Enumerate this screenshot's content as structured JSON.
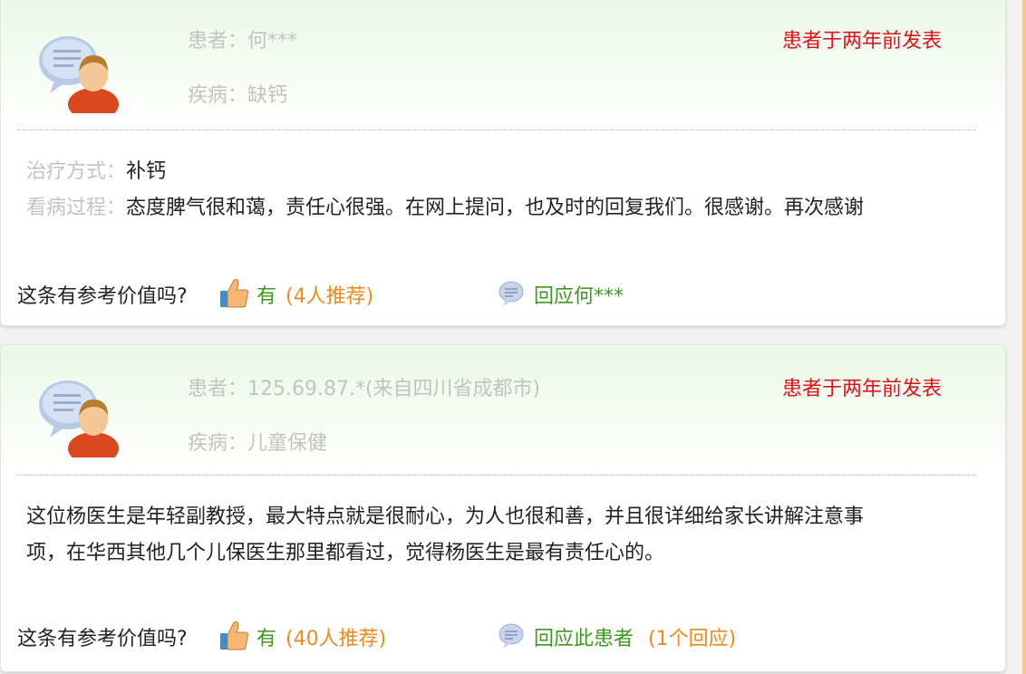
{
  "reviews": [
    {
      "patient_label": "患者：",
      "patient_name": "何***",
      "disease_label": "疾病：",
      "disease": "缺钙",
      "posted": "患者于两年前发表",
      "treatment_label": "治疗方式：",
      "treatment": "补钙",
      "process_label": "看病过程：",
      "process": "态度脾气很和蔼，责任心很强。在网上提问，也及时的回复我们。很感谢。再次感谢",
      "useful_question": "这条有参考价值吗?",
      "yes_label": "有",
      "recommend_count": "(4人推荐)",
      "reply_label": "回应何***",
      "reply_count": ""
    },
    {
      "patient_label": "患者：",
      "patient_name": "125.69.87.*(来自四川省成都市)",
      "disease_label": "疾病：",
      "disease": "儿童保健",
      "posted": "患者于两年前发表",
      "review_lines": [
        "这位杨医生是年轻副教授，最大特点就是很耐心，为人也很和善，并且很详细给家长讲解注意事",
        "项，在华西其他几个儿保医生那里都看过，觉得杨医生是最有责任心的。"
      ],
      "useful_question": "这条有参考价值吗?",
      "yes_label": "有",
      "recommend_count": "(40人推荐)",
      "reply_label": "回应此患者",
      "reply_count": "(1个回应)"
    }
  ],
  "icons": {
    "avatar": "patient-chat-avatar-icon",
    "thumb": "thumbs-up-icon",
    "bubble": "speech-bubble-icon"
  },
  "colors": {
    "posted": "#e0141e",
    "link_green": "#3d9a1e",
    "count_orange": "#f08a1b",
    "label_gray": "#c3c3c3"
  }
}
